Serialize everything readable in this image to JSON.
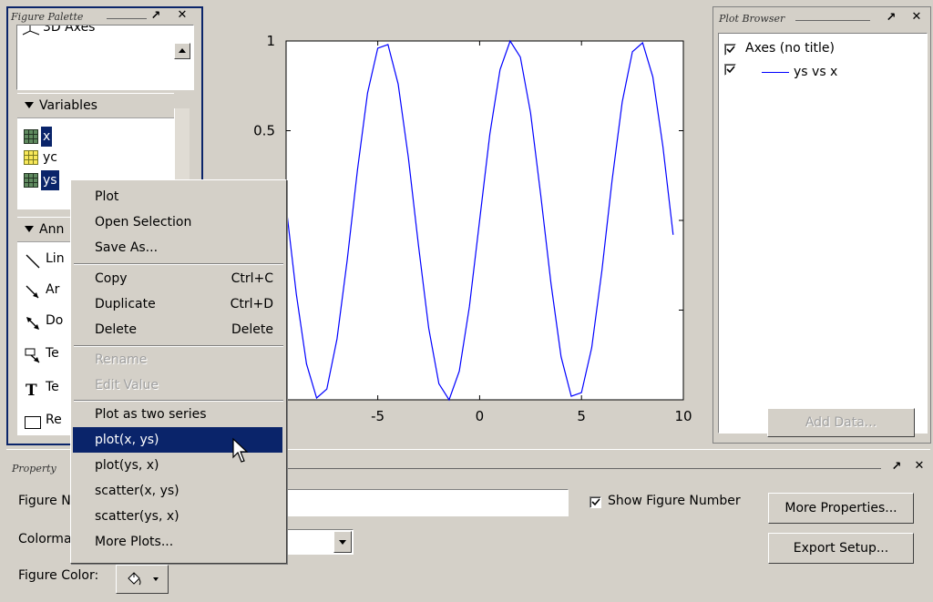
{
  "figure_palette": {
    "title": "Figure Palette",
    "first_item": "3D Axes",
    "variables_header": "Variables",
    "variables": [
      {
        "label": "x",
        "icon": "matrix-icon",
        "selected": true
      },
      {
        "label": "yc",
        "icon": "matrix-icon",
        "selected": false
      },
      {
        "label": "ys",
        "icon": "matrix-icon",
        "selected": true
      }
    ],
    "annotations_header": "Ann",
    "annotations": [
      {
        "label": "Lin",
        "icon": "line-icon"
      },
      {
        "label": "Ar",
        "icon": "arrow-icon"
      },
      {
        "label": "Do",
        "icon": "double-arrow-icon"
      },
      {
        "label": "Te",
        "icon": "text-arrow-icon"
      },
      {
        "label": "Te",
        "icon": "textbox-icon"
      },
      {
        "label": "Re",
        "icon": "rectangle-icon"
      }
    ]
  },
  "context_menu": {
    "items": [
      {
        "label": "Plot",
        "shortcut": "",
        "disabled": false,
        "highlighted": false
      },
      {
        "label": "Open Selection",
        "shortcut": "",
        "disabled": false,
        "highlighted": false
      },
      {
        "label": "Save As...",
        "shortcut": "",
        "disabled": false,
        "highlighted": false
      },
      {
        "label": "Copy",
        "shortcut": "Ctrl+C",
        "disabled": false,
        "highlighted": false
      },
      {
        "label": "Duplicate",
        "shortcut": "Ctrl+D",
        "disabled": false,
        "highlighted": false
      },
      {
        "label": "Delete",
        "shortcut": "Delete",
        "disabled": false,
        "highlighted": false
      },
      {
        "label": "Rename",
        "shortcut": "",
        "disabled": true,
        "highlighted": false
      },
      {
        "label": "Edit Value",
        "shortcut": "",
        "disabled": true,
        "highlighted": false
      },
      {
        "label": "Plot as two series",
        "shortcut": "",
        "disabled": false,
        "highlighted": false
      },
      {
        "label": "plot(x, ys)",
        "shortcut": "",
        "disabled": false,
        "highlighted": true
      },
      {
        "label": "plot(ys, x)",
        "shortcut": "",
        "disabled": false,
        "highlighted": false
      },
      {
        "label": "scatter(x, ys)",
        "shortcut": "",
        "disabled": false,
        "highlighted": false
      },
      {
        "label": "scatter(ys, x)",
        "shortcut": "",
        "disabled": false,
        "highlighted": false
      },
      {
        "label": "More Plots...",
        "shortcut": "",
        "disabled": false,
        "highlighted": false
      }
    ]
  },
  "plot_browser": {
    "title": "Plot Browser",
    "axes_label": "Axes (no title)",
    "series_label": "ys vs x",
    "add_data_button": "Add Data..."
  },
  "property_editor": {
    "title": "Property",
    "figure_name_label": "Figure N",
    "figure_name_value": "",
    "show_figure_number_label": "Show Figure Number",
    "show_figure_number_checked": true,
    "colormap_label": "Colorma",
    "figure_color_label": "Figure Color:",
    "more_properties_button": "More Properties...",
    "export_setup_button": "Export Setup..."
  },
  "chart_data": {
    "type": "line",
    "title": "",
    "xlabel": "",
    "ylabel": "",
    "xlim": [
      -9.5,
      10
    ],
    "ylim": [
      -1,
      1
    ],
    "xticks": [
      "-5",
      "0",
      "5",
      "10"
    ],
    "yticks": [
      "0.5",
      "1"
    ],
    "series": [
      {
        "color": "#0000ff",
        "x": [
          -9.5,
          -9.0,
          -8.5,
          -8.0,
          -7.5,
          -7.0,
          -6.5,
          -6.0,
          -5.5,
          -5.0,
          -4.5,
          -4.0,
          -3.5,
          -3.0,
          -2.5,
          -2.0,
          -1.5,
          -1.0,
          -0.5,
          0.0,
          0.5,
          1.0,
          1.5,
          2.0,
          2.5,
          3.0,
          3.5,
          4.0,
          4.5,
          5.0,
          5.5,
          6.0,
          6.5,
          7.0,
          7.5,
          8.0,
          8.5,
          9.0,
          9.5
        ],
        "y": [
          0.08,
          -0.41,
          -0.8,
          -0.99,
          -0.94,
          -0.66,
          -0.22,
          0.28,
          0.71,
          0.96,
          0.98,
          0.76,
          0.35,
          -0.14,
          -0.6,
          -0.91,
          -1.0,
          -0.84,
          -0.48,
          0.0,
          0.48,
          0.84,
          1.0,
          0.91,
          0.6,
          0.14,
          -0.35,
          -0.76,
          -0.98,
          -0.96,
          -0.71,
          -0.28,
          0.22,
          0.66,
          0.94,
          0.99,
          0.8,
          0.41,
          -0.08
        ]
      }
    ]
  }
}
